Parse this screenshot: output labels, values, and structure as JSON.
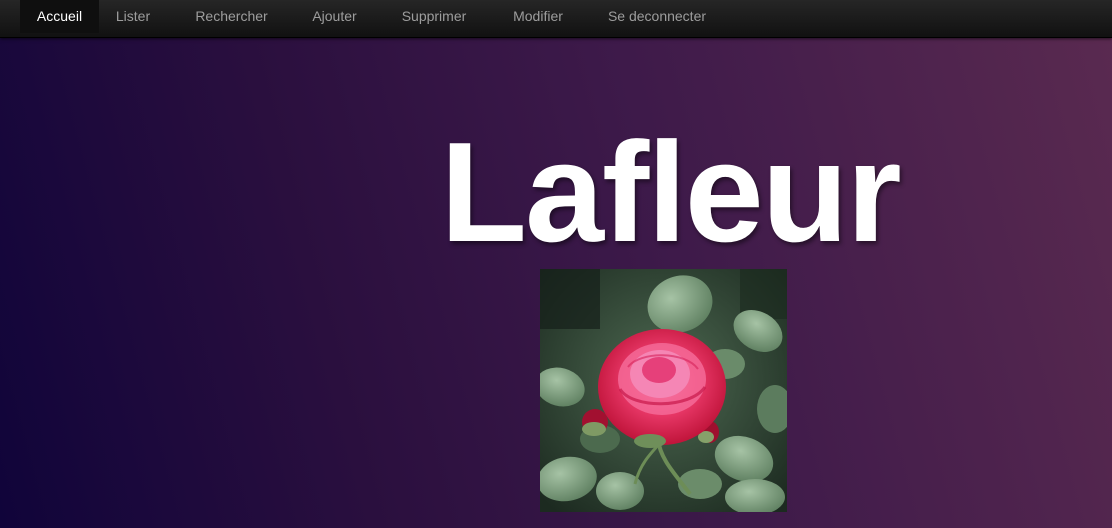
{
  "nav": {
    "items": [
      {
        "label": "Accueil",
        "active": true
      },
      {
        "label": "Lister"
      },
      {
        "label": "Rechercher"
      },
      {
        "label": "Ajouter"
      },
      {
        "label": "Supprimer"
      },
      {
        "label": "Modifier"
      },
      {
        "label": "Se deconnecter"
      }
    ]
  },
  "hero": {
    "title": "Lafleur"
  },
  "image": {
    "subject": "red-rose-photo"
  },
  "colors": {
    "navbar": "#1b1b1b",
    "nav_text": "#9d9d9d",
    "nav_active_text": "#ffffff",
    "background_dark": "#10043a",
    "background_light": "#5a2a50",
    "rose": "#e8224a"
  }
}
